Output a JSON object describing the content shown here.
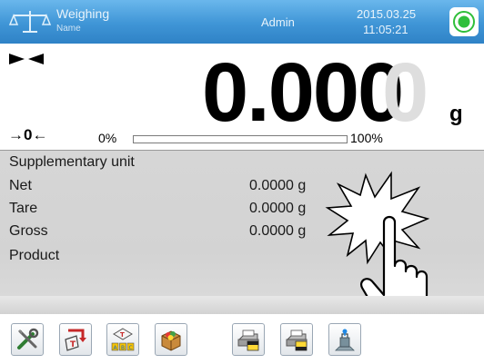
{
  "header": {
    "mode_title": "Weighing",
    "mode_sub": "Name",
    "user": "Admin",
    "date": "2015.03.25",
    "time": "11:05:21"
  },
  "display": {
    "value": "0.000",
    "ghost_digit": "0",
    "unit": "g",
    "zero_indicator": "→0←",
    "range_min": "0%",
    "range_max": "100%",
    "load_fraction": 0
  },
  "info": {
    "rows": [
      {
        "label": "Supplementary unit",
        "value": ""
      },
      {
        "label": "Net",
        "value": "0.0000 g"
      },
      {
        "label": "Tare",
        "value": "0.0000 g"
      },
      {
        "label": "Gross",
        "value": "0.0000 g"
      },
      {
        "label": "Product",
        "value": ""
      }
    ]
  },
  "toolbar": {
    "buttons": [
      {
        "icon": "settings-tools-icon"
      },
      {
        "icon": "tare-return-icon"
      },
      {
        "icon": "tare-database-icon"
      },
      {
        "icon": "product-box-icon"
      },
      {
        "icon": "printout-header-icon"
      },
      {
        "icon": "printout-footer-icon"
      },
      {
        "icon": "calibration-icon"
      }
    ]
  },
  "colors": {
    "header": "#3f95d6",
    "status_green": "#2fbf3a",
    "panel": "#d5d5d5",
    "bar_fill": "#3c8ed8"
  }
}
